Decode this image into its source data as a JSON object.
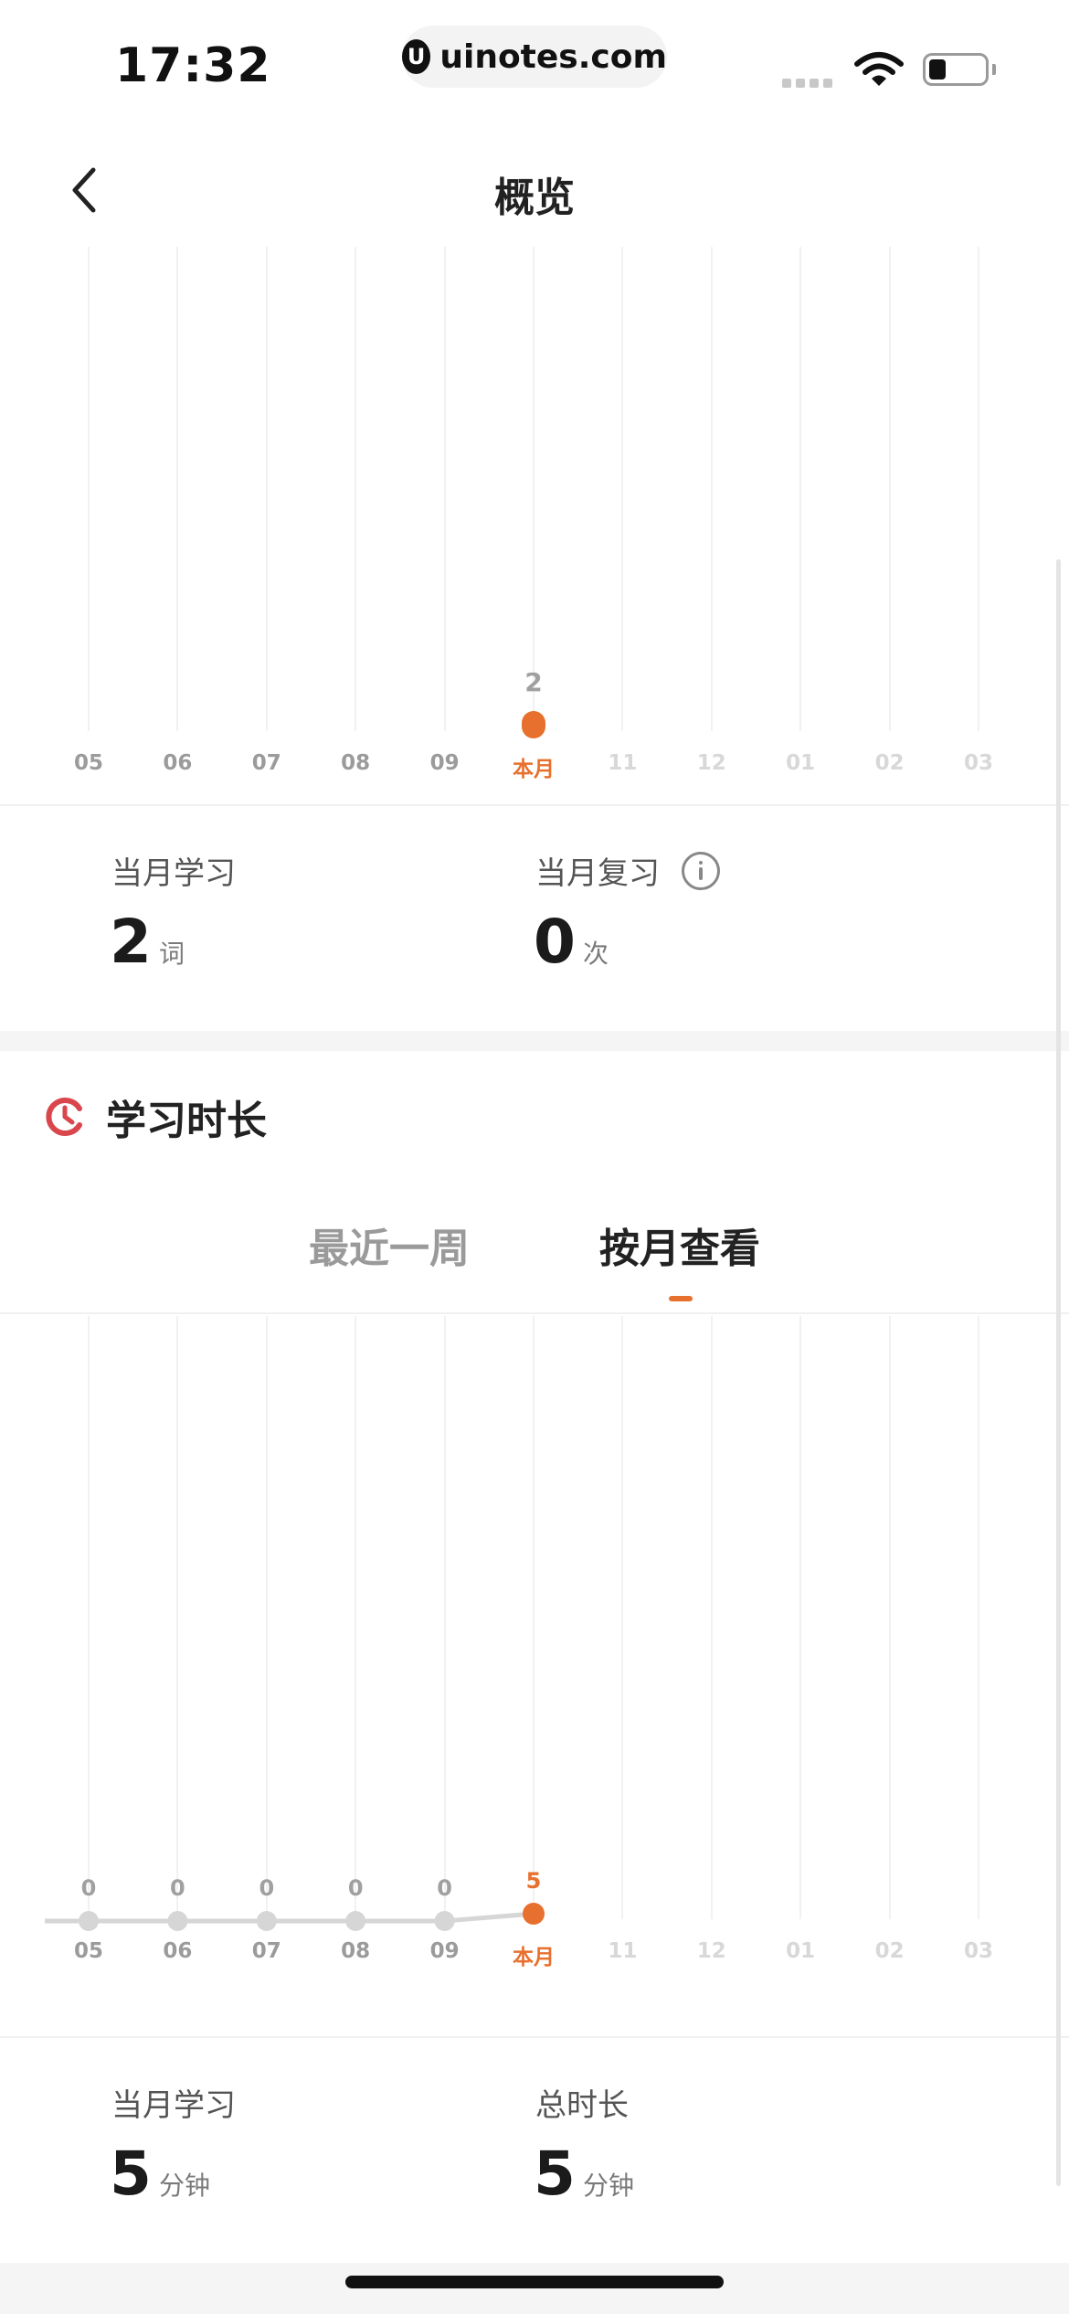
{
  "status_bar": {
    "time": "17:32",
    "url": "uinotes.com",
    "url_logo": "U"
  },
  "nav": {
    "title": "概览"
  },
  "months": [
    "05",
    "06",
    "07",
    "08",
    "09",
    "本月",
    "11",
    "12",
    "01",
    "02",
    "03"
  ],
  "current_month_index": 5,
  "colors": {
    "accent": "#e8702e",
    "past_point": "#d6d6d6",
    "section_icon": "#d9464b"
  },
  "chart_data": [
    {
      "type": "bar",
      "categories": [
        "05",
        "06",
        "07",
        "08",
        "09",
        "本月",
        "11",
        "12",
        "01",
        "02",
        "03"
      ],
      "series": [
        {
          "values": [
            null,
            null,
            null,
            null,
            null,
            2,
            null,
            null,
            null,
            null,
            null
          ]
        }
      ],
      "data_labels": [
        "",
        "",
        "",
        "",
        "",
        "2",
        "",
        "",
        "",
        "",
        ""
      ]
    },
    {
      "type": "line",
      "categories": [
        "05",
        "06",
        "07",
        "08",
        "09",
        "本月",
        "11",
        "12",
        "01",
        "02",
        "03"
      ],
      "series": [
        {
          "values": [
            0,
            0,
            0,
            0,
            0,
            5,
            null,
            null,
            null,
            null,
            null
          ]
        }
      ],
      "data_labels": [
        "0",
        "0",
        "0",
        "0",
        "0",
        "5",
        "",
        "",
        "",
        "",
        ""
      ]
    }
  ],
  "summary1": {
    "learn_label": "当月学习",
    "learn_value": "2",
    "learn_unit": "词",
    "review_label": "当月复习",
    "review_value": "0",
    "review_unit": "次"
  },
  "study_time": {
    "title": "学习时长",
    "tabs": [
      "最近一周",
      "按月查看"
    ],
    "active_tab": 1
  },
  "summary2": {
    "learn_label": "当月学习",
    "learn_value": "5",
    "learn_unit": "分钟",
    "total_label": "总时长",
    "total_value": "5",
    "total_unit": "分钟"
  }
}
